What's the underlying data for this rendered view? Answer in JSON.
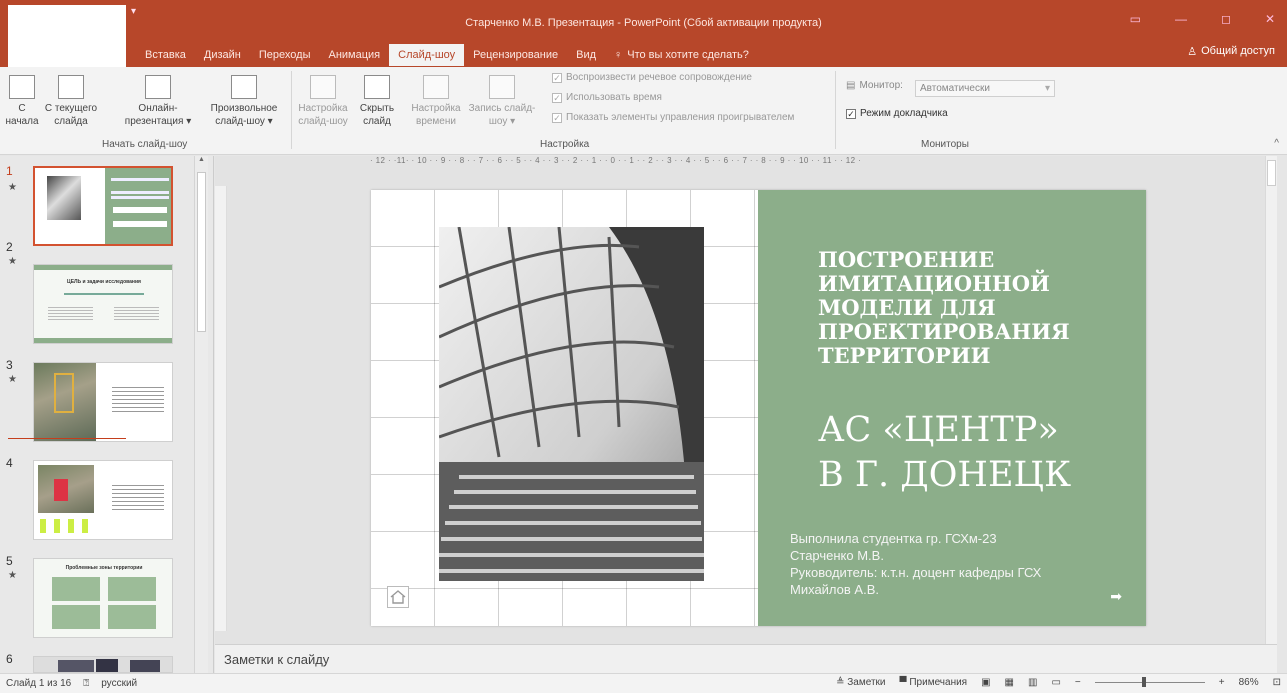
{
  "window": {
    "title": "Старченко М.В. Презентация - PowerPoint (Сбой активации продукта)",
    "share_label": "Общий доступ",
    "controls": [
      "▭",
      "—",
      "◻",
      "✕"
    ]
  },
  "tabs": [
    {
      "label": "Вставка"
    },
    {
      "label": "Дизайн"
    },
    {
      "label": "Переходы"
    },
    {
      "label": "Анимация"
    },
    {
      "label": "Слайд-шоу",
      "active": true
    },
    {
      "label": "Рецензирование"
    },
    {
      "label": "Вид"
    }
  ],
  "tell_me": "Что вы хотите сделать?",
  "ribbon": {
    "start_group": {
      "label": "Начать слайд-шоу",
      "from_start": [
        "С",
        "начала"
      ],
      "from_current": [
        "С текущего",
        "слайда"
      ],
      "online": [
        "Онлайн-",
        "презентация ▾"
      ],
      "custom": [
        "Произвольное",
        "слайд-шоу ▾"
      ]
    },
    "setup_group": {
      "label": "Настройка",
      "setup": [
        "Настройка",
        "слайд-шоу"
      ],
      "hide": [
        "Скрыть",
        "слайд"
      ],
      "rehearse": [
        "Настройка",
        "времени"
      ],
      "record": [
        "Запись слайд-",
        "шоу ▾"
      ],
      "play_narration": "Воспроизвести речевое сопровождение",
      "use_timings": "Использовать время",
      "show_controls": "Показать элементы управления проигрывателем"
    },
    "monitors_group": {
      "label": "Мониторы",
      "monitor_label": "Монитор:",
      "monitor_value": "Автоматически",
      "presenter_view": "Режим докладчика"
    }
  },
  "ruler_text": "· 12 · ·11· · 10 · · 9 · · 8 · · 7 · · 6 · · 5 · · 4 · · 3 · · 2 · · 1 · · 0 · · 1 · · 2 · · 3 · · 4 · · 5 · · 6 · · 7 · · 8 · · 9 · · 10 · · 11 · · 12 ·",
  "thumbnails": [
    {
      "num": "1",
      "star": "★"
    },
    {
      "num": "2",
      "star": "★",
      "text": "ЦЕЛЬ и задачи исследования"
    },
    {
      "num": "3",
      "star": "★"
    },
    {
      "num": "4"
    },
    {
      "num": "5",
      "star": "★",
      "text": "Проблемные зоны территории"
    },
    {
      "num": "6"
    }
  ],
  "slide": {
    "title": "ПОСТРОЕНИЕ ИМИТАЦИОННОЙ МОДЕЛИ ДЛЯ ПРОЕКТИРОВАНИЯ ТЕРРИТОРИИ",
    "big_line1": "АС «ЦЕНТР»",
    "big_line2": "В Г. ДОНЕЦК",
    "info": [
      "Выполнила студентка гр. ГСХм-23",
      "Старченко М.В.",
      "Руководитель: к.т.н. доцент кафедры ГСХ",
      "Михайлов А.В."
    ],
    "accent_color": "#8cae8a"
  },
  "notes_placeholder": "Заметки к слайду",
  "status": {
    "slide_info": "Слайд 1 из 16",
    "language": "русский",
    "notes_btn": "Заметки",
    "comments_btn": "Примечания",
    "zoom_minus": "−",
    "zoom_plus": "+",
    "zoom_level": "86%",
    "zoom_fraction": 0.43
  },
  "colors": {
    "brand": "#b7472a",
    "selection": "#d35230"
  }
}
